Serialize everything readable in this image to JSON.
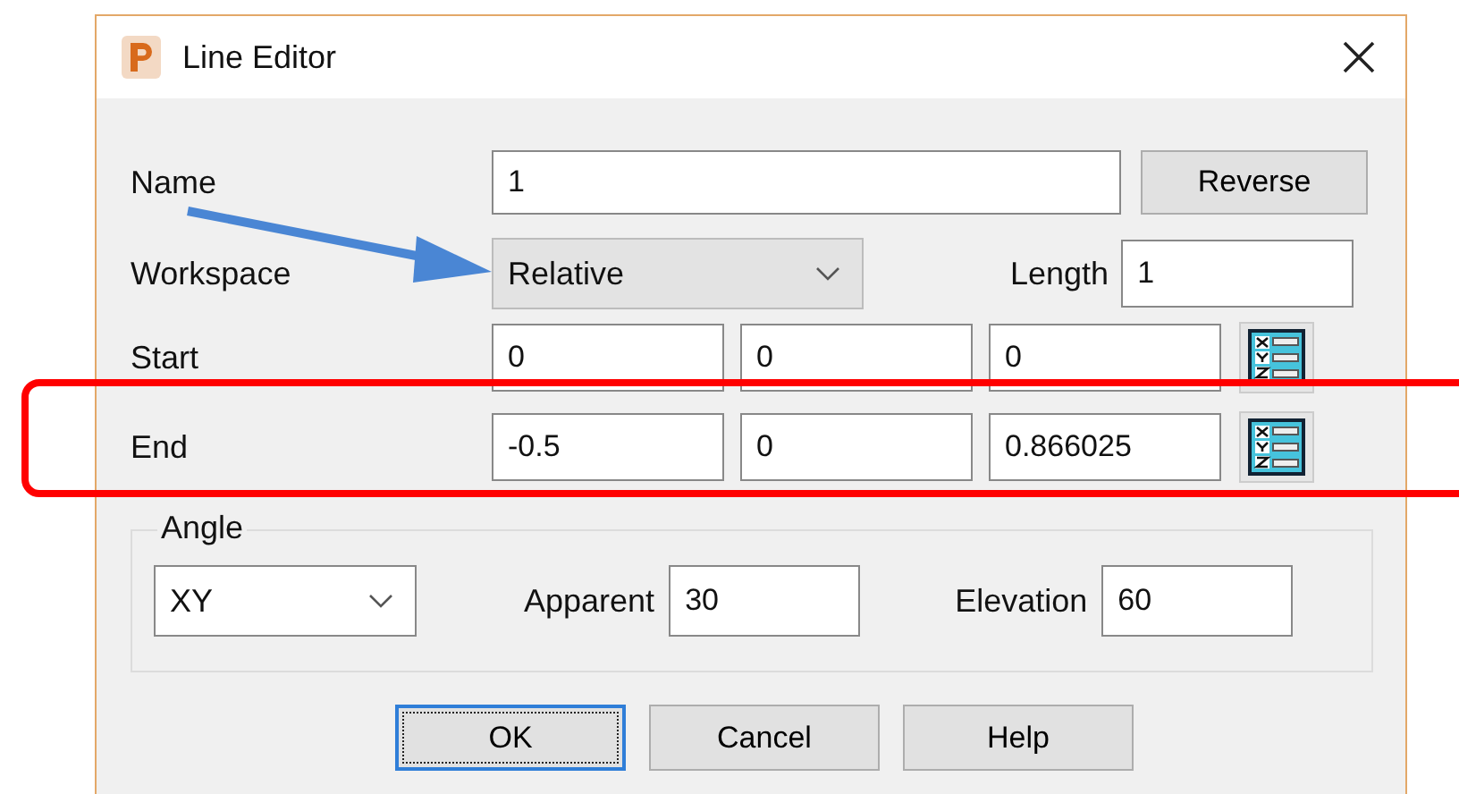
{
  "window": {
    "title": "Line Editor"
  },
  "name": {
    "label": "Name",
    "value": "1"
  },
  "reverse_button": "Reverse",
  "workspace": {
    "label": "Workspace",
    "value": "Relative"
  },
  "length": {
    "label": "Length",
    "value": "1"
  },
  "points": [
    {
      "label": "Start",
      "values": [
        "0",
        "0",
        "0"
      ]
    },
    {
      "label": "End",
      "values": [
        "-0.5",
        "0",
        "0.866025"
      ]
    }
  ],
  "angle": {
    "title": "Angle",
    "plane": "XY",
    "apparent": {
      "label": "Apparent",
      "value": "30"
    },
    "elevation": {
      "label": "Elevation",
      "value": "60"
    }
  },
  "buttons": [
    {
      "label": "OK",
      "selected": true
    },
    {
      "label": "Cancel",
      "selected": false
    },
    {
      "label": "Help",
      "selected": false
    }
  ]
}
